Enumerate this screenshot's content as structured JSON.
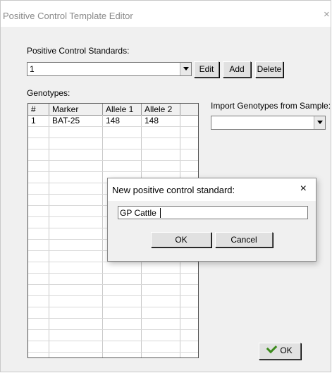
{
  "window": {
    "title": "Positive Control Template Editor",
    "close_glyph": "×"
  },
  "standards": {
    "label": "Positive Control Standards:",
    "selected": "1",
    "buttons": {
      "edit": "Edit",
      "add": "Add",
      "delete": "Delete"
    }
  },
  "genotypes": {
    "label": "Genotypes:",
    "columns": [
      "#",
      "Marker",
      "Allele 1",
      "Allele 2"
    ],
    "rows": [
      [
        "1",
        "BAT-25",
        "148",
        "148"
      ]
    ]
  },
  "import": {
    "label": "Import Genotypes from Sample:",
    "selected": ""
  },
  "ok_button": {
    "label": "OK",
    "icon": "checkmark-icon",
    "icon_color": "#3c8a1c"
  },
  "dialog": {
    "title": "New positive control standard:",
    "close_glyph": "×",
    "input_value": "GP Cattle",
    "ok_label": "OK",
    "cancel_label": "Cancel"
  }
}
